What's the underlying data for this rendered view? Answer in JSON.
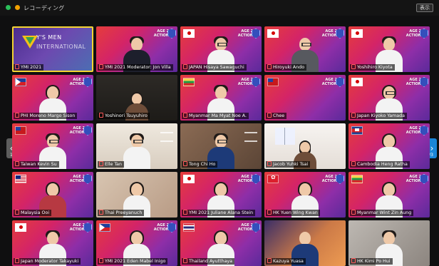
{
  "window": {
    "title": "レコーディング",
    "view_button": "表示"
  },
  "pager": {
    "left_count": "1/3",
    "right_count": "1/3"
  },
  "participants": [
    {
      "label": "YMI 2021",
      "flag": "",
      "style": "ys",
      "name_visible": true
    },
    {
      "label": "YMI 2021 Moderator: Jon Villa",
      "flag": "",
      "style": "banner",
      "name_visible": true
    },
    {
      "label": "JAPAN Hisaya Sawaguchi",
      "flag": "jp",
      "style": "banner",
      "name_visible": true
    },
    {
      "label": "Hiroyuki Ando",
      "flag": "jp",
      "style": "banner",
      "name_visible": true
    },
    {
      "label": "Yoshihiro Kiyota",
      "flag": "jp",
      "style": "banner",
      "name_visible": true
    },
    {
      "label": "PHI Moreno Margo Sison",
      "flag": "ph",
      "style": "banner",
      "name_visible": true
    },
    {
      "label": "Yoshinori Tsuyuhiro",
      "flag": "",
      "style": "room-dark",
      "name_visible": true
    },
    {
      "label": "Myanmar Ma Myat Noe A.",
      "flag": "mm",
      "style": "banner",
      "name_visible": true
    },
    {
      "label": "Chee",
      "flag": "jp",
      "style": "banner",
      "name_visible": true
    },
    {
      "label": "Japan Kiyoko Yamada",
      "flag": "jp",
      "style": "banner",
      "name_visible": true
    },
    {
      "label": "Taiwan Kevin Su",
      "flag": "tw",
      "style": "banner",
      "name_visible": true
    },
    {
      "label": "Elle Tan",
      "flag": "",
      "style": "room-light",
      "name_visible": true
    },
    {
      "label": "Tong Chi Ho",
      "flag": "",
      "style": "room-brown",
      "name_visible": true
    },
    {
      "label": "Jacob Yuhki Tsai",
      "flag": "",
      "style": "room-white",
      "name_visible": true
    },
    {
      "label": "Cambodia Heng Ratha",
      "flag": "kh",
      "style": "banner",
      "name_visible": true
    },
    {
      "label": "Malaysia Ooi",
      "flag": "my",
      "style": "banner",
      "name_visible": true
    },
    {
      "label": "Thai Preeyanuch",
      "flag": "",
      "style": "room-warm",
      "name_visible": true
    },
    {
      "label": "YMI 2021 Juliane Alana Stein",
      "flag": "jp",
      "style": "banner",
      "name_visible": true
    },
    {
      "label": "HK Yuen Wing Kwan",
      "flag": "hk",
      "style": "banner",
      "name_visible": true
    },
    {
      "label": "Myanmar Wint Zin Aung",
      "flag": "mm",
      "style": "banner",
      "name_visible": true
    },
    {
      "label": "Japan Moderator Takayuki",
      "flag": "jp",
      "style": "banner",
      "name_visible": true
    },
    {
      "label": "YMI 2021 Eden Mabel Inigo",
      "flag": "ph",
      "style": "banner",
      "name_visible": true
    },
    {
      "label": "Thailand Ayutthaya",
      "flag": "th",
      "style": "banner",
      "name_visible": true
    },
    {
      "label": "Kazuya Yuasa",
      "flag": "",
      "style": "room-red",
      "name_visible": true
    },
    {
      "label": "HK Kimi Po Hui",
      "flag": "",
      "style": "room-gray",
      "name_visible": true
    }
  ]
}
